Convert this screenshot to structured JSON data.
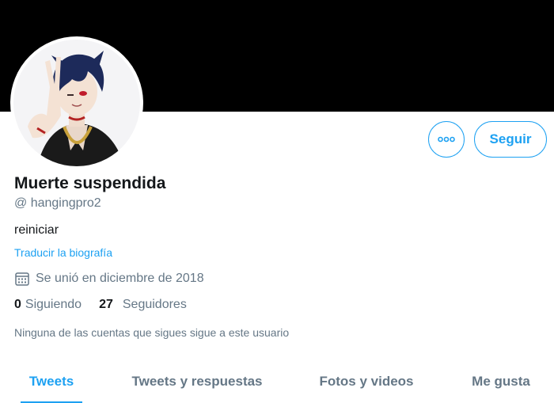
{
  "profile": {
    "display_name": "Muerte suspendida",
    "handle": "@ hangingpro2",
    "bio": "reiniciar",
    "translate_link": "Traducir la biografía",
    "joined": "Se unió en diciembre de 2018",
    "following_count": "0",
    "following_label": "Siguiendo",
    "followers_count": "27",
    "followers_label": "Seguidores",
    "known_followers": "Ninguna de las cuentas que sigues sigue a este usuario"
  },
  "actions": {
    "more_icon": "more-options-icon",
    "follow_label": "Seguir"
  },
  "tabs": [
    {
      "label": "Tweets",
      "active": true
    },
    {
      "label": "Tweets y respuestas",
      "active": false
    },
    {
      "label": "Fotos y videos",
      "active": false
    },
    {
      "label": "Me gusta",
      "active": false
    }
  ],
  "colors": {
    "accent": "#1da1f2",
    "text_primary": "#14171a",
    "text_secondary": "#657786",
    "banner": "#000000"
  }
}
